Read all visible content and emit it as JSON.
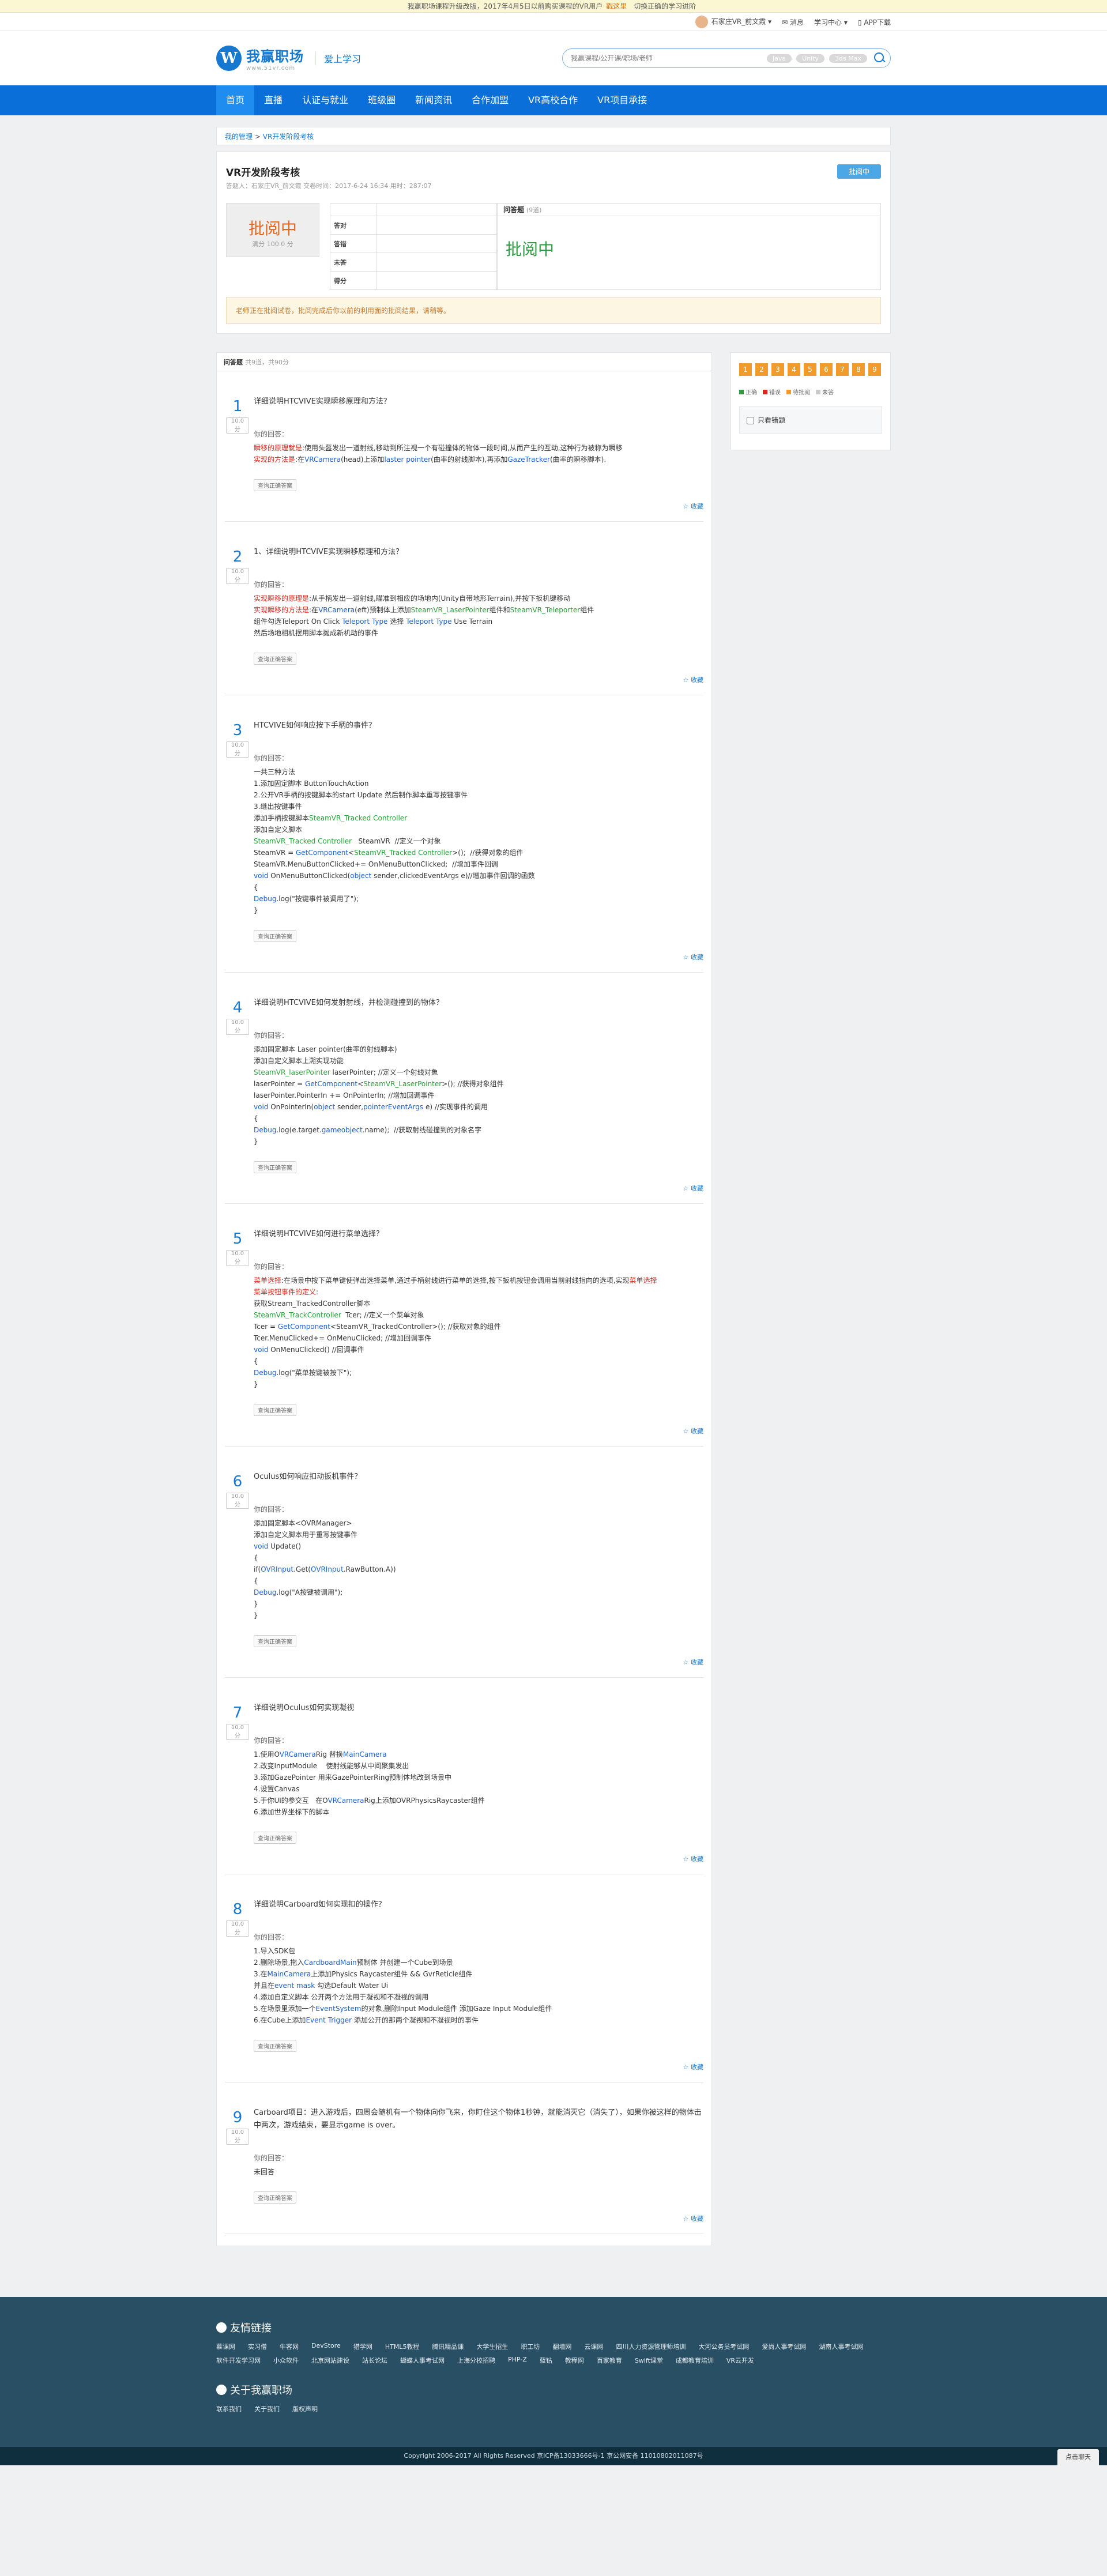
{
  "notice": {
    "text": "我赢职场课程升级改版，2017年4月5日以前购买课程的VR用户",
    "link": "戳这里",
    "suffix": "切换正确的学习进阶"
  },
  "topbar": {
    "user": "石家庄VR_前文霞",
    "message": "消息",
    "learn": "学习中心",
    "app": "APP下载"
  },
  "logo": {
    "name": "我赢职场",
    "domain": "www.51vr.com",
    "slogan": "爱上学习"
  },
  "search": {
    "placeholder": "我赢课程/公开课/职场/老师",
    "tags": [
      "Java",
      "Unity",
      "3ds Max"
    ]
  },
  "nav": [
    "首页",
    "直播",
    "认证与就业",
    "班级圈",
    "新闻资讯",
    "合作加盟",
    "VR高校合作",
    "VR项目承接"
  ],
  "breadcrumb": {
    "home": "我的管理",
    "sep": ">",
    "current": "VR开发阶段考核"
  },
  "exam": {
    "title": "VR开发阶段考核",
    "meta": "答题人：石家庄VR_前文霞  交卷时间：2017-6-24 16:34  用时：287:07",
    "badge": "批阅中",
    "status": "批阅中",
    "score_label": "满分 100.0 分",
    "rows": [
      {
        "k": "答对",
        "v": ""
      },
      {
        "k": "答错",
        "v": ""
      },
      {
        "k": "未答",
        "v": ""
      },
      {
        "k": "得分",
        "v": ""
      }
    ],
    "qa_label": "问答题",
    "qa_count": "(9道)",
    "qa_status": "批阅中",
    "warn": "老师正在批阅试卷，批阅完成后你以前的利用面的批阅结果，请稍等。"
  },
  "questions_header": {
    "title": "问答题",
    "count": "共9道，共90分"
  },
  "questions": [
    {
      "n": "1",
      "score": "10.0分",
      "title": "详细说明HTCVIVE实现瞬移原理和方法？",
      "label": "你的回答：",
      "answer": "瞬移的原理就是:使用头盔发出一道射线,移动到所注视一个有碰撞体的物体一段时间,从而产生的互动,这种行为被称为瞬移\n实现的方法是:在VRCamera(head)上添加laster pointer(曲率的射线脚本),再添加GazeTracker(曲率的瞬移脚本)."
    },
    {
      "n": "2",
      "score": "10.0分",
      "title": "1、详细说明HTCVIVE实现瞬移原理和方法？",
      "label": "你的回答：",
      "answer": "实现瞬移的原理是:从手柄发出一道射线,瞄准到相应的场地内(Unity自带地形Terrain),并按下扳机键移动\n实现瞬移的方法是:在VRCamera(eft)预制体上添加SteamVR_LaserPointer组件和SteamVR_Teleporter组件\n组件勾选Teleport On Click Teleport Type 选择 Teleport Type Use Terrain\n然后场地相机摆用脚本抛成新机动的事件"
    },
    {
      "n": "3",
      "score": "10.0分",
      "title": "HTCVIVE如何响应按下手柄的事件？",
      "label": "你的回答：",
      "answer": "一共三种方法\n1.添加固定脚本 ButtonTouchAction\n2.公开VR手柄的按键脚本的start Update 然后制作脚本重写按键事件\n3.继出按键事件\n添加手柄按键脚本SteamVR_Tracked Controller\n添加自定义脚本\nSteamVR_Tracked Controller   SteamVR  //定义一个对象\nSteamVR = GetComponent<SteamVR_Tracked Controller>();  //获得对象的组件\nSteamVR.MenuButtonClicked+= OnMenuButtonClicked;  //增加事件回调\nvoid OnMenuButtonClicked(object sender,clickedEventArgs e)//增加事件回调的函数\n{\nDebug.log(\"按键事件被调用了\");\n}"
    },
    {
      "n": "4",
      "score": "10.0分",
      "title": "详细说明HTCVIVE如何发射射线，并检测碰撞到的物体？",
      "label": "你的回答：",
      "answer": "添加固定脚本 Laser pointer(曲率的射线脚本)\n添加自定义脚本上溯实现功能\nSteamVR_laserPointer laserPointer; //定义一个射线对象\nlaserPointer = GetComponent<SteamVR_LaserPointer>(); //获得对象组件\nlaserPointer.PointerIn += OnPointerIn; //增加回调事件\nvoid OnPointerIn(object sender,pointerEventArgs e) //实现事件的调用\n{\nDebug.log(e.target.gameobject.name);  //获取射线碰撞到的对象名字\n}"
    },
    {
      "n": "5",
      "score": "10.0分",
      "title": "详细说明HTCVIVE如何进行菜单选择？",
      "label": "你的回答：",
      "answer": "菜单选择:在场景中按下菜单键使弹出选择菜单,通过手柄射线进行菜单的选择,按下扳机按钮会调用当前射线指向的选项,实现菜单选择\n菜单按钮事件的定义:\n获取Stream_TrackedController脚本\nSteamVR_TrackController  Tcer; //定义一个菜单对象\nTcer = GetComponent<SteamVR_TrackedController>(); //获取对象的组件\nTcer.MenuClicked+= OnMenuClicked; //增加回调事件\nvoid OnMenuClicked() //回调事件\n{\nDebug.log(\"菜单按键被按下\");\n}"
    },
    {
      "n": "6",
      "score": "10.0分",
      "title": "Oculus如何响应扣动扳机事件？",
      "label": "你的回答：",
      "answer": "添加固定脚本<OVRManager>\n添加自定义脚本用于重写按键事件\nvoid Update()\n{\nif(OVRInput.Get(OVRInput.RawButton.A))\n{\nDebug.log(\"A按键被调用\");\n}\n}"
    },
    {
      "n": "7",
      "score": "10.0分",
      "title": "详细说明Oculus如何实现凝视",
      "label": "你的回答：",
      "answer": "1.使用OVRCameraRig 替换MainCamera\n2.改变InputModule    使射线能够从中间聚集发出\n3.添加GazePointer 用来GazePointerRing预制体地改到场景中\n4.设置Canvas\n5.于你UI的参交互   在OVRCameraRig上添加OVRPhysicsRaycaster组件\n6.添加世界坐标下的脚本"
    },
    {
      "n": "8",
      "score": "10.0分",
      "title": "详细说明Carboard如何实现扣的操作？",
      "label": "你的回答：",
      "answer": "1.导入SDK包\n2.删除场景,拖入CardboardMain预制体 并创建一个Cube到场景\n3.在MainCamera上添加Physics Raycaster组件 && GvrReticle组件\n并且在event mask 勾选Default Water Ui\n4.添加自定义脚本 公开两个方法用于凝视和不凝视的调用\n5.在场景里添加一个EventSystem的对象,删除Input Module组件 添加Gaze Input Module组件\n6.在Cube上添加Event Trigger 添加公开的那两个凝视和不凝视时的事件"
    },
    {
      "n": "9",
      "score": "10.0分",
      "title": "Carboard项目：进入游戏后，四周会随机有一个物体向你飞来，你盯住这个物体1秒钟，就能消灭它（消失了），如果你被这样的物体击中两次，游戏结束，要显示game is over。",
      "label": "你的回答：",
      "answer": "未回答"
    }
  ],
  "common": {
    "key_button": "查询正确答案",
    "fav": "收藏"
  },
  "sidebar": {
    "numbers": [
      "1",
      "2",
      "3",
      "4",
      "5",
      "6",
      "7",
      "8",
      "9"
    ],
    "legend": [
      "正确",
      "错误",
      "待批阅",
      "未答"
    ],
    "legend_colors": [
      "#2e9a43",
      "#d9281e",
      "#f09b2a",
      "#cccccc"
    ],
    "only_wrong": "只看错题"
  },
  "footer": {
    "links_title": "友情链接",
    "links": [
      "慕课网",
      "实习僧",
      "牛客网",
      "DevStore",
      "猎学网",
      "HTML5教程",
      "腾讯精品课",
      "大学生招生",
      "职工坊",
      "翻墙网",
      "云课网",
      "四川人力资源管理师培训",
      "大河公务员考试网",
      "爱尚人事考试网",
      "湖南人事考试网",
      "软件开发学习网",
      "小众软件",
      "北京网站建设",
      "站长论坛",
      "蝴蝶人事考试网",
      "上海分校招聘",
      "PHP-Z",
      "蓝钻",
      "教程网",
      "百家教育",
      "Swift课堂",
      "成都教育培训",
      "VR云开发"
    ],
    "about_title": "关于我赢职场",
    "about": [
      "联系我们",
      "关于我们",
      "版权声明"
    ],
    "copyright": "Copyright 2006-2017 All Rights Reserved 京ICP备13033666号-1 京公网安备 11010802011087号",
    "float": "点击聊天"
  }
}
